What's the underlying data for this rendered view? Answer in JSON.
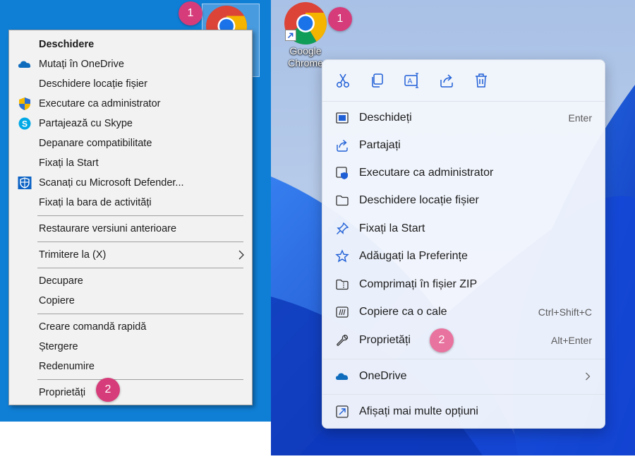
{
  "left_panel": {
    "badge_1": "1",
    "badge_2": "2",
    "menu": {
      "items_group1": [
        {
          "label": "Deschidere",
          "icon": null
        },
        {
          "label": "Mutați în OneDrive",
          "icon": "onedrive-cloud-icon"
        },
        {
          "label": "Deschidere locație fișier",
          "icon": null
        },
        {
          "label": "Executare ca administrator",
          "icon": "uac-shield-icon"
        },
        {
          "label": "Partajează cu Skype",
          "icon": "skype-icon"
        },
        {
          "label": "Depanare compatibilitate",
          "icon": null
        },
        {
          "label": "Fixați la Start",
          "icon": null
        },
        {
          "label": "Scanați cu Microsoft Defender...",
          "icon": "defender-icon"
        },
        {
          "label": "Fixați la bara de activități",
          "icon": null
        }
      ],
      "restore": "Restaurare versiuni anterioare",
      "send_to": "Trimitere la (X)",
      "cut": "Decupare",
      "copy": "Copiere",
      "create_shortcut": "Creare comandă rapidă",
      "delete": "Ștergere",
      "rename": "Redenumire",
      "properties": "Proprietăți"
    }
  },
  "right_panel": {
    "badge_1": "1",
    "badge_2": "2",
    "desktop_icon_label": "Google Chrome",
    "toolbar_icons": [
      "cut-icon",
      "copy-icon",
      "rename-icon",
      "share-icon",
      "delete-icon"
    ],
    "menu": {
      "open": {
        "label": "Deschideți",
        "shortcut": "Enter"
      },
      "share": {
        "label": "Partajați"
      },
      "run_as_admin": {
        "label": "Executare ca administrator"
      },
      "open_location": {
        "label": "Deschidere locație fișier"
      },
      "pin_start": {
        "label": "Fixați la Start"
      },
      "add_favorites": {
        "label": "Adăugați la Preferințe"
      },
      "compress_zip": {
        "label": "Comprimați în fișier ZIP"
      },
      "copy_path": {
        "label": "Copiere ca o cale",
        "shortcut": "Ctrl+Shift+C"
      },
      "properties": {
        "label": "Proprietăți",
        "shortcut": "Alt+Enter"
      },
      "onedrive": {
        "label": "OneDrive"
      },
      "more_options": {
        "label": "Afișați mai multe opțiuni"
      }
    }
  },
  "colors": {
    "win10_desktop": "#0f7fd6",
    "badge": "#d63c7a",
    "win11_accent": "#1f5fd6"
  }
}
